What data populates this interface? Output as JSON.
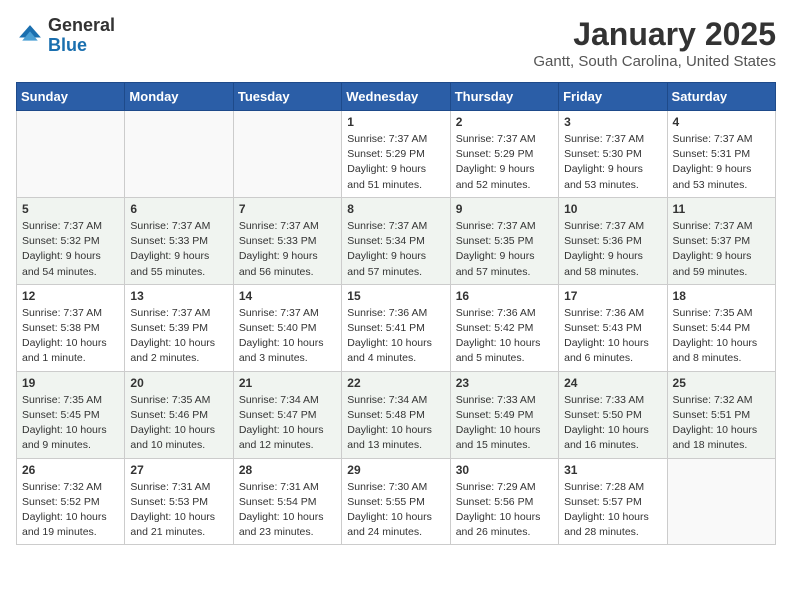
{
  "header": {
    "logo_general": "General",
    "logo_blue": "Blue",
    "title": "January 2025",
    "subtitle": "Gantt, South Carolina, United States"
  },
  "weekdays": [
    "Sunday",
    "Monday",
    "Tuesday",
    "Wednesday",
    "Thursday",
    "Friday",
    "Saturday"
  ],
  "weeks": [
    [
      {
        "day": "",
        "info": ""
      },
      {
        "day": "",
        "info": ""
      },
      {
        "day": "",
        "info": ""
      },
      {
        "day": "1",
        "info": "Sunrise: 7:37 AM\nSunset: 5:29 PM\nDaylight: 9 hours\nand 51 minutes."
      },
      {
        "day": "2",
        "info": "Sunrise: 7:37 AM\nSunset: 5:29 PM\nDaylight: 9 hours\nand 52 minutes."
      },
      {
        "day": "3",
        "info": "Sunrise: 7:37 AM\nSunset: 5:30 PM\nDaylight: 9 hours\nand 53 minutes."
      },
      {
        "day": "4",
        "info": "Sunrise: 7:37 AM\nSunset: 5:31 PM\nDaylight: 9 hours\nand 53 minutes."
      }
    ],
    [
      {
        "day": "5",
        "info": "Sunrise: 7:37 AM\nSunset: 5:32 PM\nDaylight: 9 hours\nand 54 minutes."
      },
      {
        "day": "6",
        "info": "Sunrise: 7:37 AM\nSunset: 5:33 PM\nDaylight: 9 hours\nand 55 minutes."
      },
      {
        "day": "7",
        "info": "Sunrise: 7:37 AM\nSunset: 5:33 PM\nDaylight: 9 hours\nand 56 minutes."
      },
      {
        "day": "8",
        "info": "Sunrise: 7:37 AM\nSunset: 5:34 PM\nDaylight: 9 hours\nand 57 minutes."
      },
      {
        "day": "9",
        "info": "Sunrise: 7:37 AM\nSunset: 5:35 PM\nDaylight: 9 hours\nand 57 minutes."
      },
      {
        "day": "10",
        "info": "Sunrise: 7:37 AM\nSunset: 5:36 PM\nDaylight: 9 hours\nand 58 minutes."
      },
      {
        "day": "11",
        "info": "Sunrise: 7:37 AM\nSunset: 5:37 PM\nDaylight: 9 hours\nand 59 minutes."
      }
    ],
    [
      {
        "day": "12",
        "info": "Sunrise: 7:37 AM\nSunset: 5:38 PM\nDaylight: 10 hours\nand 1 minute."
      },
      {
        "day": "13",
        "info": "Sunrise: 7:37 AM\nSunset: 5:39 PM\nDaylight: 10 hours\nand 2 minutes."
      },
      {
        "day": "14",
        "info": "Sunrise: 7:37 AM\nSunset: 5:40 PM\nDaylight: 10 hours\nand 3 minutes."
      },
      {
        "day": "15",
        "info": "Sunrise: 7:36 AM\nSunset: 5:41 PM\nDaylight: 10 hours\nand 4 minutes."
      },
      {
        "day": "16",
        "info": "Sunrise: 7:36 AM\nSunset: 5:42 PM\nDaylight: 10 hours\nand 5 minutes."
      },
      {
        "day": "17",
        "info": "Sunrise: 7:36 AM\nSunset: 5:43 PM\nDaylight: 10 hours\nand 6 minutes."
      },
      {
        "day": "18",
        "info": "Sunrise: 7:35 AM\nSunset: 5:44 PM\nDaylight: 10 hours\nand 8 minutes."
      }
    ],
    [
      {
        "day": "19",
        "info": "Sunrise: 7:35 AM\nSunset: 5:45 PM\nDaylight: 10 hours\nand 9 minutes."
      },
      {
        "day": "20",
        "info": "Sunrise: 7:35 AM\nSunset: 5:46 PM\nDaylight: 10 hours\nand 10 minutes."
      },
      {
        "day": "21",
        "info": "Sunrise: 7:34 AM\nSunset: 5:47 PM\nDaylight: 10 hours\nand 12 minutes."
      },
      {
        "day": "22",
        "info": "Sunrise: 7:34 AM\nSunset: 5:48 PM\nDaylight: 10 hours\nand 13 minutes."
      },
      {
        "day": "23",
        "info": "Sunrise: 7:33 AM\nSunset: 5:49 PM\nDaylight: 10 hours\nand 15 minutes."
      },
      {
        "day": "24",
        "info": "Sunrise: 7:33 AM\nSunset: 5:50 PM\nDaylight: 10 hours\nand 16 minutes."
      },
      {
        "day": "25",
        "info": "Sunrise: 7:32 AM\nSunset: 5:51 PM\nDaylight: 10 hours\nand 18 minutes."
      }
    ],
    [
      {
        "day": "26",
        "info": "Sunrise: 7:32 AM\nSunset: 5:52 PM\nDaylight: 10 hours\nand 19 minutes."
      },
      {
        "day": "27",
        "info": "Sunrise: 7:31 AM\nSunset: 5:53 PM\nDaylight: 10 hours\nand 21 minutes."
      },
      {
        "day": "28",
        "info": "Sunrise: 7:31 AM\nSunset: 5:54 PM\nDaylight: 10 hours\nand 23 minutes."
      },
      {
        "day": "29",
        "info": "Sunrise: 7:30 AM\nSunset: 5:55 PM\nDaylight: 10 hours\nand 24 minutes."
      },
      {
        "day": "30",
        "info": "Sunrise: 7:29 AM\nSunset: 5:56 PM\nDaylight: 10 hours\nand 26 minutes."
      },
      {
        "day": "31",
        "info": "Sunrise: 7:28 AM\nSunset: 5:57 PM\nDaylight: 10 hours\nand 28 minutes."
      },
      {
        "day": "",
        "info": ""
      }
    ]
  ]
}
